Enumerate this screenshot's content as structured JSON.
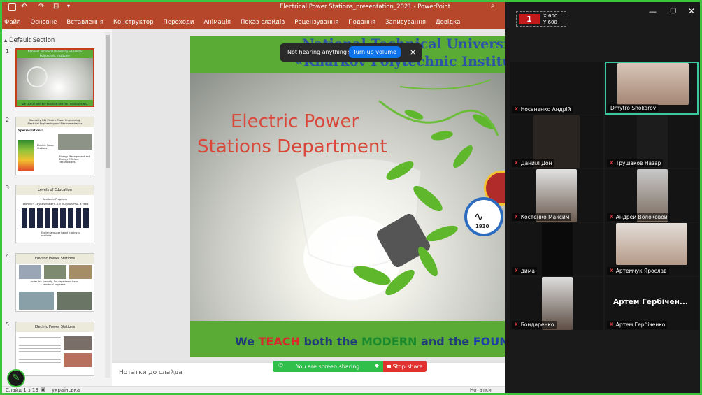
{
  "app": {
    "window_title": "Electrical Power Stations_presentation_2021 - PowerPoint",
    "ribbon_tabs": [
      "Файл",
      "Основне",
      "Вставлення",
      "Конструктор",
      "Переходи",
      "Анімація",
      "Показ слайдів",
      "Рецензування",
      "Подання",
      "Записування",
      "Довідка"
    ],
    "section": "Default Section",
    "notes_placeholder": "Нотатки до слайда",
    "status": {
      "slide": "Слайд 1 з 13",
      "language": "українська",
      "notes_btn": "Нотатки"
    }
  },
  "thumbnails": [
    {
      "num": "1",
      "title": "National Technical University «Kharkov Polytechnic Institute»",
      "footer": "We TEACH both the MODERN and the FOUNDATIONAL"
    },
    {
      "num": "2",
      "title": "Speciality 141 Electric Power Engineering, Electrical Engineering and Electromechanics",
      "sub": "Specializations:",
      "a": "Electric Power Stations",
      "b": "Energy Management and Energy Efficient Technologies"
    },
    {
      "num": "3",
      "title": "Levels of Education",
      "sub": "Academic Programs",
      "a": "Bachelor's - 4 years  Master's - 1,5 or 2 years  PhD - 4 years",
      "b": "English language based training is available"
    },
    {
      "num": "4",
      "title": "Electric Power Stations",
      "a": "under this specialty, the department trains electrical engineers"
    },
    {
      "num": "5",
      "title": "Electric Power Stations"
    }
  ],
  "slide": {
    "header_line1": "National Technical University",
    "header_line2": "«Kharkov Polytechnic Institute»",
    "title_line1": "Electric Power",
    "title_line2": "Stations Department",
    "logo_year": "1930",
    "footer": {
      "we": "We",
      "teach": "TEACH",
      "both": "both the",
      "modern": "MODERN",
      "and": "and the",
      "found": "FOUNDATIONAL"
    }
  },
  "overlays": {
    "hint": "Not hearing anything?",
    "turn_up": "Turn up volume",
    "close": "×",
    "sharing": "You are screen sharing",
    "stop": "Stop share"
  },
  "zoom": {
    "resolution_x": "X 600",
    "resolution_y": "Y 600",
    "participants": [
      {
        "name": "Носаненко Андрій"
      },
      {
        "name": "Dmytro Shokarov"
      },
      {
        "name": "Даниїл Дон"
      },
      {
        "name": "Трушаков Назар"
      },
      {
        "name": "Костенко Максим"
      },
      {
        "name": "Андрей Волоковой"
      },
      {
        "name": "дима"
      },
      {
        "name": "Артемчук Ярослав"
      },
      {
        "name": "Бондаренко"
      },
      {
        "name": "Артем Гербіченко",
        "overlay": "Артем Гербічен..."
      }
    ]
  },
  "colors": {
    "ppt_red": "#b7472a",
    "slide_green": "#5aaa36",
    "title_red": "#d9483b",
    "share_green": "#2fbf4a",
    "share_red": "#e0322e",
    "zoom_blue": "#0e72ed"
  }
}
